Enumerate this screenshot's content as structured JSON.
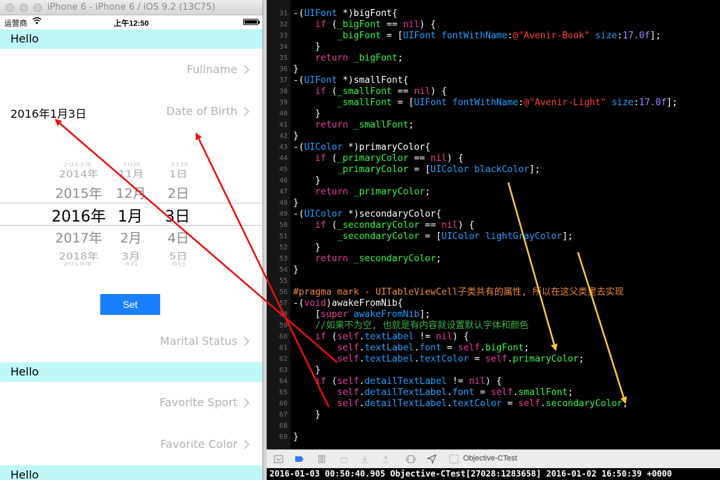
{
  "simulator": {
    "window_title": "iPhone 6 - iPhone 6 / iOS 9.2 (13C75)",
    "status": {
      "carrier": "运营商",
      "time": "上午12:50"
    },
    "rows": [
      {
        "type": "header",
        "text": "Hello"
      },
      {
        "type": "cell",
        "label": "Fullname",
        "value": ""
      },
      {
        "type": "cell",
        "label": "Date of Birth",
        "value": "2016年1月3日"
      },
      {
        "type": "cell",
        "label": "Marital Status",
        "value": ""
      },
      {
        "type": "header",
        "text": "Hello"
      },
      {
        "type": "cell",
        "label": "Favorite Sport",
        "value": ""
      },
      {
        "type": "cell",
        "label": "Favorite Color",
        "value": ""
      },
      {
        "type": "header",
        "text": "Hello"
      }
    ],
    "picker": {
      "rows": [
        [
          "2013年",
          "10月",
          "31日"
        ],
        [
          "2014年",
          "11月",
          "1日"
        ],
        [
          "2015年",
          "12月",
          "2日"
        ],
        [
          "2016年",
          "1月",
          "3日"
        ],
        [
          "2017年",
          "2月",
          "4日"
        ],
        [
          "2018年",
          "3月",
          "5日"
        ],
        [
          "2019年",
          "4月",
          "6日"
        ]
      ],
      "selected_index": 3
    },
    "set_button": "Set"
  },
  "editor": {
    "lines": [
      {
        "n": "31",
        "segs": [
          [
            "pl",
            "-("
          ],
          [
            "ty",
            "UIFont"
          ],
          [
            "pl",
            " *)bigFont{"
          ]
        ]
      },
      {
        "n": "32",
        "segs": [
          [
            "pl",
            "    "
          ],
          [
            "kw",
            "if"
          ],
          [
            "pl",
            " ("
          ],
          [
            "iv",
            "_bigFont"
          ],
          [
            "pl",
            " == "
          ],
          [
            "kw",
            "nil"
          ],
          [
            "pl",
            ") {"
          ]
        ]
      },
      {
        "n": "33",
        "segs": [
          [
            "pl",
            "        "
          ],
          [
            "iv",
            "_bigFont"
          ],
          [
            "pl",
            " = ["
          ],
          [
            "ty",
            "UIFont fontWithName"
          ],
          [
            "pl",
            ":"
          ],
          [
            "str",
            "@\"Avenir-Book\""
          ],
          [
            "pl",
            " "
          ],
          [
            "ty",
            "size"
          ],
          [
            "pl",
            ":"
          ],
          [
            "num",
            "17.0f"
          ],
          [
            "pl",
            "];"
          ]
        ]
      },
      {
        "n": "34",
        "segs": [
          [
            "pl",
            "    }"
          ]
        ]
      },
      {
        "n": "35",
        "segs": [
          [
            "pl",
            "    "
          ],
          [
            "kw",
            "return"
          ],
          [
            "pl",
            " "
          ],
          [
            "iv",
            "_bigFont"
          ],
          [
            "pl",
            ";"
          ]
        ]
      },
      {
        "n": "36",
        "segs": [
          [
            "pl",
            "}"
          ]
        ]
      },
      {
        "n": "37",
        "segs": [
          [
            "pl",
            "-("
          ],
          [
            "ty",
            "UIFont"
          ],
          [
            "pl",
            " *)smallFont{"
          ]
        ]
      },
      {
        "n": "38",
        "segs": [
          [
            "pl",
            "    "
          ],
          [
            "kw",
            "if"
          ],
          [
            "pl",
            " ("
          ],
          [
            "iv",
            "_smallFont"
          ],
          [
            "pl",
            " == "
          ],
          [
            "kw",
            "nil"
          ],
          [
            "pl",
            ") {"
          ]
        ]
      },
      {
        "n": "39",
        "segs": [
          [
            "pl",
            "        "
          ],
          [
            "iv",
            "_smallFont"
          ],
          [
            "pl",
            " = ["
          ],
          [
            "ty",
            "UIFont fontWithName"
          ],
          [
            "pl",
            ":"
          ],
          [
            "str",
            "@\"Avenir-Light\""
          ],
          [
            "pl",
            " "
          ],
          [
            "ty",
            "size"
          ],
          [
            "pl",
            ":"
          ],
          [
            "num",
            "17.0f"
          ],
          [
            "pl",
            "];"
          ]
        ]
      },
      {
        "n": "40",
        "segs": [
          [
            "pl",
            "    }"
          ]
        ]
      },
      {
        "n": "41",
        "segs": [
          [
            "pl",
            "    "
          ],
          [
            "kw",
            "return"
          ],
          [
            "pl",
            " "
          ],
          [
            "iv",
            "_smallFont"
          ],
          [
            "pl",
            ";"
          ]
        ]
      },
      {
        "n": "42",
        "segs": [
          [
            "pl",
            "}"
          ]
        ]
      },
      {
        "n": "43",
        "segs": [
          [
            "pl",
            "-("
          ],
          [
            "ty",
            "UIColor"
          ],
          [
            "pl",
            " *)primaryColor{"
          ]
        ]
      },
      {
        "n": "44",
        "segs": [
          [
            "pl",
            "    "
          ],
          [
            "kw",
            "if"
          ],
          [
            "pl",
            " ("
          ],
          [
            "iv",
            "_primaryColor"
          ],
          [
            "pl",
            " == "
          ],
          [
            "kw",
            "nil"
          ],
          [
            "pl",
            ") {"
          ]
        ]
      },
      {
        "n": "45",
        "segs": [
          [
            "pl",
            "        "
          ],
          [
            "iv",
            "_primaryColor"
          ],
          [
            "pl",
            " = ["
          ],
          [
            "ty",
            "UIColor blackColor"
          ],
          [
            "pl",
            "];"
          ]
        ]
      },
      {
        "n": "46",
        "segs": [
          [
            "pl",
            "    }"
          ]
        ]
      },
      {
        "n": "47",
        "segs": [
          [
            "pl",
            "    "
          ],
          [
            "kw",
            "return"
          ],
          [
            "pl",
            " "
          ],
          [
            "iv",
            "_primaryColor"
          ],
          [
            "pl",
            ";"
          ]
        ]
      },
      {
        "n": "48",
        "segs": [
          [
            "pl",
            "}"
          ]
        ]
      },
      {
        "n": "49",
        "segs": [
          [
            "pl",
            "-("
          ],
          [
            "ty",
            "UIColor"
          ],
          [
            "pl",
            " *)secondaryColor{"
          ]
        ]
      },
      {
        "n": "50",
        "segs": [
          [
            "pl",
            "    "
          ],
          [
            "kw",
            "if"
          ],
          [
            "pl",
            " ("
          ],
          [
            "iv",
            "_secondaryColor"
          ],
          [
            "pl",
            " == "
          ],
          [
            "kw",
            "nil"
          ],
          [
            "pl",
            ") {"
          ]
        ]
      },
      {
        "n": "51",
        "segs": [
          [
            "pl",
            "        "
          ],
          [
            "iv",
            "_secondaryColor"
          ],
          [
            "pl",
            " = ["
          ],
          [
            "ty",
            "UIColor lightGrayColor"
          ],
          [
            "pl",
            "];"
          ]
        ]
      },
      {
        "n": "52",
        "segs": [
          [
            "pl",
            "    }"
          ]
        ]
      },
      {
        "n": "53",
        "segs": [
          [
            "pl",
            "    "
          ],
          [
            "kw",
            "return"
          ],
          [
            "pl",
            " "
          ],
          [
            "iv",
            "_secondaryColor"
          ],
          [
            "pl",
            ";"
          ]
        ]
      },
      {
        "n": "54",
        "segs": [
          [
            "pl",
            "}"
          ]
        ]
      },
      {
        "n": "55",
        "segs": []
      },
      {
        "n": "56",
        "segs": [
          [
            "pr",
            "#pragma mark - UITableViewCell子类共有的属性, 所以在这父类里去实现"
          ]
        ]
      },
      {
        "n": "57",
        "segs": [
          [
            "pl",
            "-("
          ],
          [
            "kw",
            "void"
          ],
          [
            "pl",
            ")awakeFromNib{"
          ]
        ]
      },
      {
        "n": "58",
        "segs": [
          [
            "pl",
            "    ["
          ],
          [
            "kw",
            "super"
          ],
          [
            "pl",
            " "
          ],
          [
            "ty",
            "awakeFromNib"
          ],
          [
            "pl",
            "];"
          ]
        ]
      },
      {
        "n": "59",
        "segs": [
          [
            "cm",
            "    //如果不为空, 也就是有内容就设置默认字体和颜色"
          ]
        ]
      },
      {
        "n": "60",
        "segs": [
          [
            "pl",
            "    "
          ],
          [
            "kw",
            "if"
          ],
          [
            "pl",
            " ("
          ],
          [
            "kw",
            "self"
          ],
          [
            "pl",
            "."
          ],
          [
            "ty",
            "textLabel"
          ],
          [
            "pl",
            " != "
          ],
          [
            "kw",
            "nil"
          ],
          [
            "pl",
            ") {"
          ]
        ]
      },
      {
        "n": "61",
        "segs": [
          [
            "pl",
            "        "
          ],
          [
            "kw",
            "self"
          ],
          [
            "pl",
            "."
          ],
          [
            "ty",
            "textLabel"
          ],
          [
            "pl",
            "."
          ],
          [
            "ty",
            "font"
          ],
          [
            "pl",
            " = "
          ],
          [
            "kw",
            "self"
          ],
          [
            "pl",
            "."
          ],
          [
            "iv",
            "bigFont"
          ],
          [
            "pl",
            ";"
          ]
        ]
      },
      {
        "n": "62",
        "segs": [
          [
            "pl",
            "        "
          ],
          [
            "kw",
            "self"
          ],
          [
            "pl",
            "."
          ],
          [
            "ty",
            "textLabel"
          ],
          [
            "pl",
            "."
          ],
          [
            "ty",
            "textColor"
          ],
          [
            "pl",
            " = "
          ],
          [
            "kw",
            "self"
          ],
          [
            "pl",
            "."
          ],
          [
            "iv",
            "primaryColor"
          ],
          [
            "pl",
            ";"
          ]
        ]
      },
      {
        "n": "63",
        "segs": [
          [
            "pl",
            "    }"
          ]
        ]
      },
      {
        "n": "64",
        "segs": [
          [
            "pl",
            "    "
          ],
          [
            "kw",
            "if"
          ],
          [
            "pl",
            " ("
          ],
          [
            "kw",
            "self"
          ],
          [
            "pl",
            "."
          ],
          [
            "ty",
            "detailTextLabel"
          ],
          [
            "pl",
            " != "
          ],
          [
            "kw",
            "nil"
          ],
          [
            "pl",
            ") {"
          ]
        ]
      },
      {
        "n": "65",
        "segs": [
          [
            "pl",
            "        "
          ],
          [
            "kw",
            "self"
          ],
          [
            "pl",
            "."
          ],
          [
            "ty",
            "detailTextLabel"
          ],
          [
            "pl",
            "."
          ],
          [
            "ty",
            "font"
          ],
          [
            "pl",
            " = "
          ],
          [
            "kw",
            "self"
          ],
          [
            "pl",
            "."
          ],
          [
            "iv",
            "smallFont"
          ],
          [
            "pl",
            ";"
          ]
        ]
      },
      {
        "n": "66",
        "segs": [
          [
            "pl",
            "        "
          ],
          [
            "kw",
            "self"
          ],
          [
            "pl",
            "."
          ],
          [
            "ty",
            "detailTextLabel"
          ],
          [
            "pl",
            "."
          ],
          [
            "ty",
            "textColor"
          ],
          [
            "pl",
            " = "
          ],
          [
            "kw",
            "self"
          ],
          [
            "pl",
            "."
          ],
          [
            "iv",
            "secondaryColor"
          ],
          [
            "pl",
            ";"
          ]
        ]
      },
      {
        "n": "67",
        "segs": [
          [
            "pl",
            "    }"
          ]
        ]
      },
      {
        "n": "68",
        "segs": []
      },
      {
        "n": "69",
        "segs": [
          [
            "pl",
            "}"
          ]
        ]
      }
    ]
  },
  "debugbar": {
    "target": "Objective-CTest"
  },
  "console": {
    "text": "2016-01-03 00:50:40.905 Objective-CTest[27028:1283658] 2016-01-02 16:50:39 +0000"
  },
  "colors": {
    "header_bg": "#bff7f7",
    "set_button_bg": "#1a7fff",
    "annotation_red": "#e81010",
    "annotation_yellow": "#f8c63a"
  }
}
